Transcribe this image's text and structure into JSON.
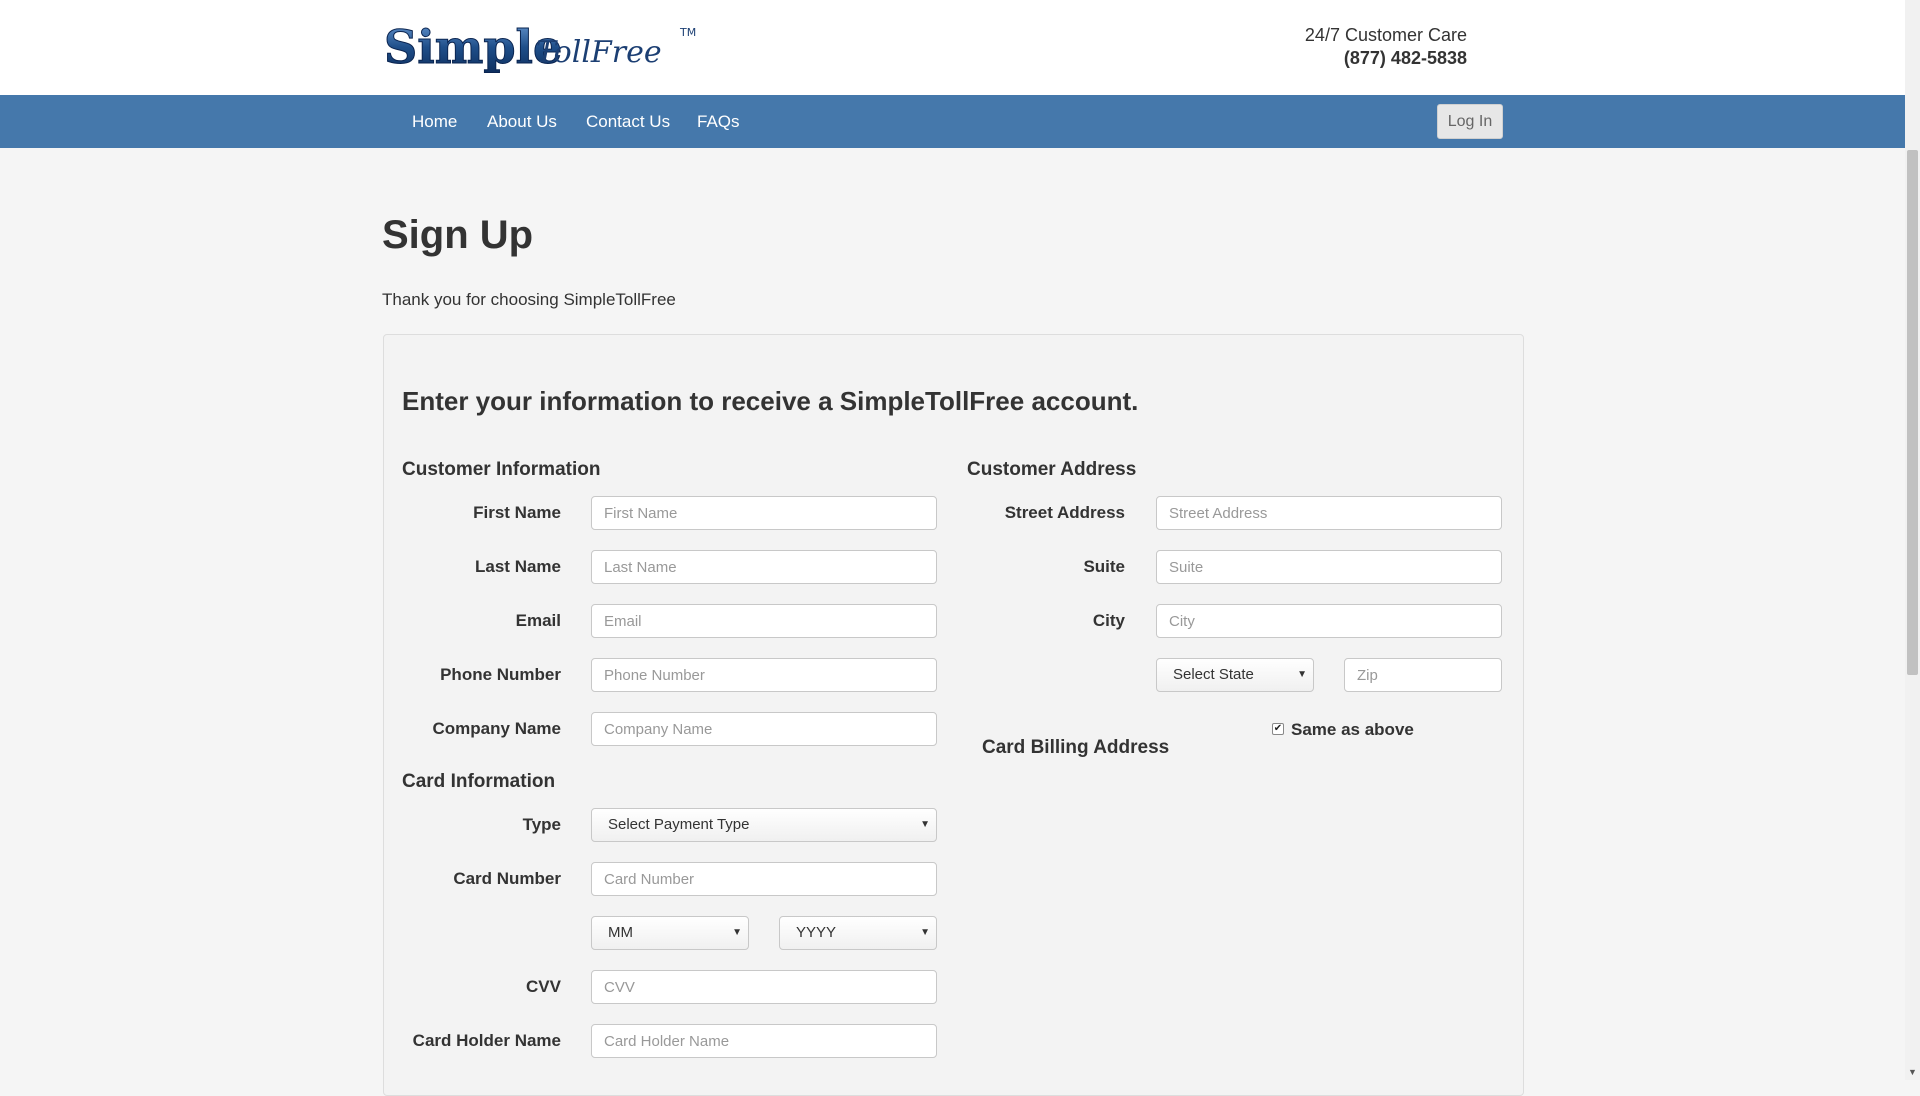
{
  "header": {
    "logo_text_simple": "Simple",
    "logo_text_tollfree": "TollFree",
    "logo_tm": "TM",
    "care_label": "24/7 Customer Care",
    "care_phone": "(877) 482-5838"
  },
  "nav": {
    "items": [
      "Home",
      "About Us",
      "Contact Us",
      "FAQs"
    ],
    "login_label": "Log In"
  },
  "page": {
    "title": "Sign Up",
    "subtitle": "Thank you for choosing SimpleTollFree",
    "panel_heading": "Enter your information to receive a SimpleTollFree account."
  },
  "customer_info": {
    "title": "Customer Information",
    "first_name_label": "First Name",
    "first_name_placeholder": "First Name",
    "last_name_label": "Last Name",
    "last_name_placeholder": "Last Name",
    "email_label": "Email",
    "email_placeholder": "Email",
    "phone_label": "Phone Number",
    "phone_placeholder": "Phone Number",
    "company_label": "Company Name",
    "company_placeholder": "Company Name"
  },
  "card_info": {
    "title": "Card Information",
    "type_label": "Type",
    "type_value": "Select Payment Type",
    "card_number_label": "Card Number",
    "card_number_placeholder": "Card Number",
    "month_value": "MM",
    "year_value": "YYYY",
    "cvv_label": "CVV",
    "cvv_placeholder": "CVV",
    "holder_label": "Card Holder Name",
    "holder_placeholder": "Card Holder Name"
  },
  "customer_address": {
    "title": "Customer Address",
    "street_label": "Street Address",
    "street_placeholder": "Street Address",
    "suite_label": "Suite",
    "suite_placeholder": "Suite",
    "city_label": "City",
    "city_placeholder": "City",
    "state_value": "Select State",
    "zip_placeholder": "Zip"
  },
  "billing": {
    "title": "Card Billing Address",
    "same_as_above_label": "Same as above",
    "same_as_above_checked": true
  },
  "colors": {
    "nav_bg": "#4578ab",
    "logo_blue": "#1f4f8a"
  }
}
